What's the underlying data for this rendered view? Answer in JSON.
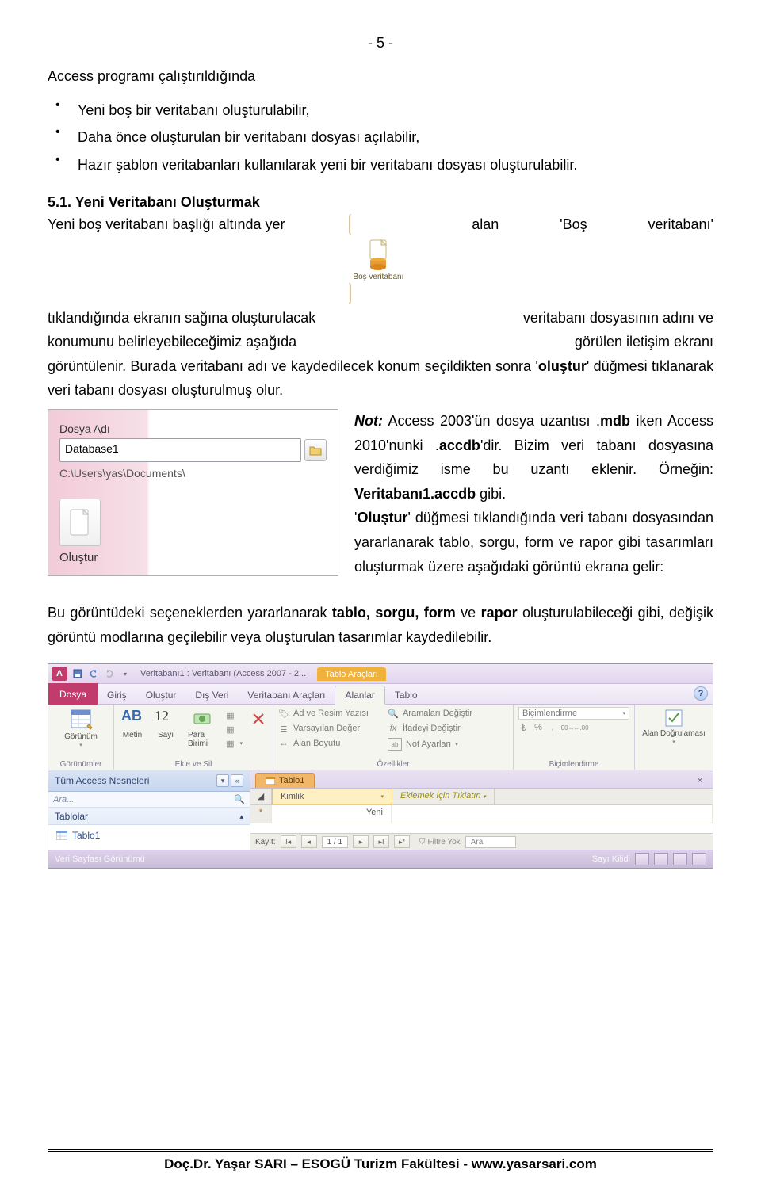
{
  "page_number": "- 5 -",
  "intro_line": "Access programı çalıştırıldığında",
  "bullets": [
    "Yeni boş bir veritabanı oluşturulabilir,",
    "Daha önce oluşturulan bir veritabanı dosyası açılabilir,",
    "Hazır şablon veritabanları kullanılarak yeni bir veritabanı dosyası oluşturulabilir."
  ],
  "heading": "5.1. Yeni Veritabanı Oluşturmak",
  "inline_icon_caption": "Boş veritabanı",
  "para_wrap": {
    "l1a": "Yeni boş veritabanı başlığı altında yer",
    "l1b": "alan",
    "l1c": "'Boş",
    "l1d": "veritabanı'",
    "l2a": "tıklandığında ekranın sağına oluşturulacak",
    "l2b": "veritabanı dosyasının adını ve",
    "l3a": "konumunu belirleyebileceğimiz aşağıda",
    "l3b": "görülen iletişim ekranı",
    "l4": "görüntülenir. Burada veritabanı adı ve kaydedilecek konum seçildikten sonra '",
    "l4b": "oluştur",
    "l4c": "' düğmesi tıklanarak veri tabanı dosyası oluşturulmuş olur."
  },
  "file_dialog": {
    "label": "Dosya Adı",
    "value": "Database1",
    "path": "C:\\Users\\yas\\Documents\\",
    "create": "Oluştur"
  },
  "note": {
    "lead": "Not:",
    "l1": " Access 2003'ün dosya uzantısı .",
    "l1b": "mdb",
    "l2": " iken Access 2010'nunki .",
    "l2b": "accdb",
    "l2c": "'dir. Bizim veri tabanı dosyasına verdiğimiz isme bu uzantı eklenir. Örneğin: ",
    "l2d": "Veritabanı1.accdb",
    "l2e": " gibi.",
    "l3a": "'",
    "l3b": "Oluştur",
    "l3c": "' düğmesi tıklandığında veri tabanı dosyasından yararlanarak tablo, sorgu, form ve rapor gibi tasarımları oluşturmak üzere aşağıdaki görüntü ekrana gelir:"
  },
  "para_after_a": "Bu görüntüdeki seçeneklerden yararlanarak ",
  "para_after_b": "tablo, sorgu, form",
  "para_after_c": " ve ",
  "para_after_d": "rapor",
  "para_after_e": " oluşturulabileceği gibi, değişik görüntü modlarına geçilebilir veya oluşturulan tasarımlar kaydedilebilir.",
  "ribbon": {
    "app_letter": "A",
    "title": "Veritabanı1 : Veritabanı (Access 2007 - 2...",
    "ctx_tab": "Tablo Araçları",
    "file_tab": "Dosya",
    "tabs": [
      "Giriş",
      "Oluştur",
      "Dış Veri",
      "Veritabanı Araçları",
      "Alanlar",
      "Tablo"
    ],
    "active_tab_index": 4,
    "group_views": {
      "big": "Görünüm",
      "label": "Görünümler"
    },
    "group_addremove": {
      "items": [
        {
          "text": "AB",
          "sub": "Metin"
        },
        {
          "text": "12",
          "sub": "Sayı"
        },
        {
          "text": "",
          "sub": "Para Birimi"
        }
      ],
      "label": "Ekle ve Sil"
    },
    "group_props": {
      "rows": [
        {
          "icon": "tag",
          "text": "Ad ve Resim Yazısı"
        },
        {
          "icon": "fx",
          "text": "Varsayılan Değer"
        },
        {
          "icon": "ruler",
          "text": "Alan Boyutu"
        }
      ],
      "rows2": [
        {
          "icon": "search",
          "text": "Aramaları Değiştir"
        },
        {
          "icon": "fx2",
          "text": "İfadeyi Değiştir"
        },
        {
          "icon": "ab",
          "text": "Not Ayarları"
        }
      ],
      "label": "Özellikler"
    },
    "group_format": {
      "big": "Biçimlendirme",
      "label": "Biçimlendirme"
    },
    "group_validation": {
      "big": "Alan Doğrulaması",
      "label": ""
    },
    "nav": {
      "title": "Tüm Access Nesneleri",
      "search": "Ara...",
      "group": "Tablolar",
      "item": "Tablo1"
    },
    "doc_tab": "Tablo1",
    "columns": {
      "id": "Kimlik",
      "add": "Eklemek İçin Tıklatın"
    },
    "row_new": "Yeni",
    "recnav": {
      "label": "Kayıt:",
      "pos": "1 / 1",
      "filter": "Filtre Yok",
      "search": "Ara"
    },
    "status_left": "Veri Sayfası Görünümü",
    "status_right": "Sayı Kilidi"
  },
  "footer": "Doç.Dr. Yaşar SARI – ESOGÜ Turizm Fakültesi - www.yasarsari.com"
}
